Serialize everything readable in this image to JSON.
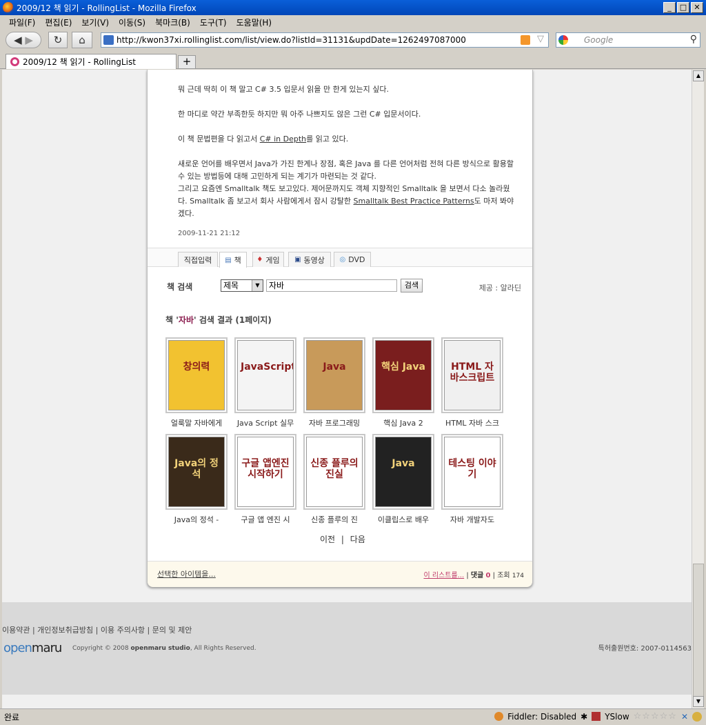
{
  "window": {
    "title": "2009/12 책 읽기 - RollingList - Mozilla Firefox"
  },
  "menu": [
    "파일(F)",
    "편집(E)",
    "보기(V)",
    "이동(S)",
    "북마크(B)",
    "도구(T)",
    "도움말(H)"
  ],
  "nav": {
    "url": "http://kwon37xi.rollinglist.com/list/view.do?listId=31131&updDate=1262497087000",
    "search_placeholder": "Google"
  },
  "tab": {
    "title": "2009/12 책 읽기 - RollingList"
  },
  "content": {
    "p1": "뭐 근데 딱히 이 책 말고 C# 3.5 입문서 읽을 만 한게 있는지 싶다.",
    "p2": "한 마디로 약간 부족한듯 하지만 뭐 아주 나쁘지도 않은 그런 C# 입문서이다.",
    "p3_pre": "이 책 문법편을 다 읽고서 ",
    "p3_link": "C# in Depth",
    "p3_post": "를 읽고 있다.",
    "p4": "새로운 언어를 배우면서 Java가 가진 한계나 장점, 혹은 Java 를 다른 언어처럼 전혀 다른 방식으로 활용할 수 있는 방법등에 대해 고민하게 되는 계기가 마련되는 것 같다.",
    "p5_pre": "그리고 요즘엔 Smalltalk 책도 보고있다. 제어문까지도 객체 지향적인 Smalltalk 을 보면서 다소 놀라웠다. Smalltalk 좀 보고서 회사 사람에게서 잠시 강탈한 ",
    "p5_link": "Smalltalk Best Practice Patterns",
    "p5_post": "도 마저 봐야겠다.",
    "date": "2009-11-21 21:12"
  },
  "input_tabs": [
    "직접입력",
    "책",
    "게임",
    "동영상",
    "DVD"
  ],
  "book_search": {
    "label": "책 검색",
    "select": "제목",
    "query": "자바",
    "button": "검색",
    "provider": "제공 : 알라딘",
    "result_prefix": "책 '",
    "result_query": "자바",
    "result_suffix": "' 검색 결과 (1페이지)"
  },
  "books": [
    {
      "title": "얼룩말 자바에게",
      "cover_text": "창의력",
      "color": "#f2c230"
    },
    {
      "title": "Java Script 실무",
      "cover_text": "JavaScript",
      "color": "#f4f4f4"
    },
    {
      "title": "자바 프로그래밍",
      "cover_text": "Java",
      "color": "#c89a5a"
    },
    {
      "title": "핵심 Java 2",
      "cover_text": "핵심 Java",
      "color": "#7a1e1e"
    },
    {
      "title": "HTML 자바 스크",
      "cover_text": "HTML 자바스크립트",
      "color": "#f0f0f0"
    },
    {
      "title": "Java의 정석 -",
      "cover_text": "Java의 정석",
      "color": "#3a2a1a"
    },
    {
      "title": "구글 앱 엔진 시",
      "cover_text": "구글 앱엔진 시작하기",
      "color": "#ffffff"
    },
    {
      "title": "신종 플루의 진",
      "cover_text": "신종 플루의 진실",
      "color": "#ffffff"
    },
    {
      "title": "이클립스로 배우",
      "cover_text": "Java",
      "color": "#222222"
    },
    {
      "title": "자바 개발자도",
      "cover_text": "테스팅 이야기",
      "color": "#ffffff"
    }
  ],
  "pager": {
    "prev": "이전",
    "sep": "|",
    "next": "다음"
  },
  "card_footer": {
    "selected": "선택한 아이템을...",
    "list_link": "이 리스트를...",
    "comments_label": "댓글",
    "comments": "0",
    "views_label": "조회",
    "views": "174"
  },
  "footer": {
    "links": "이용약관 | 개인정보취급방침 | 이용 주의사항 | 문의 및 제안",
    "logo_o": "open",
    "logo_rest": "maru",
    "copyright_pre": "Copyright © 2008 ",
    "copyright_bold": "openmaru studio",
    "copyright_post": ", All Rights Reserved.",
    "patent": "특허출원번호: 2007-0114563"
  },
  "status": {
    "text": "완료",
    "fiddler": "Fiddler: Disabled",
    "yslow": "YSlow"
  }
}
